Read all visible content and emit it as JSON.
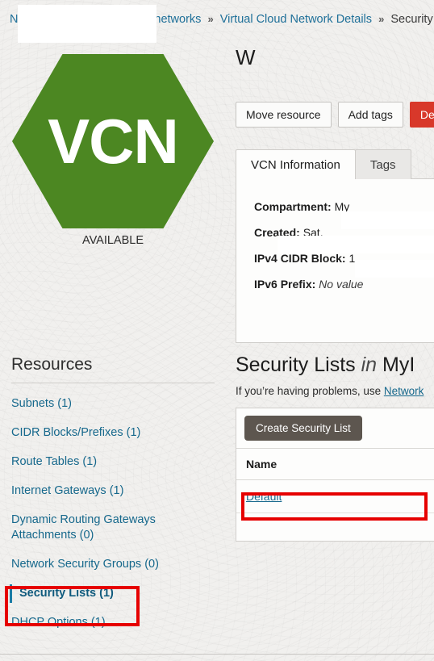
{
  "breadcrumb": {
    "items": [
      {
        "label": "Networking",
        "link": true
      },
      {
        "label": "Virtual cloud networks",
        "link": true
      },
      {
        "label": "Virtual Cloud Network Details",
        "link": true
      },
      {
        "label": "Security Lists",
        "link": false
      }
    ],
    "separator": "»"
  },
  "resource_badge": {
    "hex_label": "VCN",
    "hex_color": "#4c8722",
    "status": "AVAILABLE"
  },
  "detail": {
    "title": "W",
    "buttons": [
      {
        "label": "Move resource",
        "style": "default"
      },
      {
        "label": "Add tags",
        "style": "default"
      },
      {
        "label": "Dele",
        "style": "danger"
      }
    ],
    "tabs": [
      {
        "label": "VCN Information",
        "active": true
      },
      {
        "label": "Tags",
        "active": false
      }
    ],
    "info": [
      {
        "label": "Compartment:",
        "value": "My",
        "italic": false
      },
      {
        "label": "Created:",
        "value": "Sat,",
        "italic": false
      },
      {
        "label": "IPv4 CIDR Block:",
        "value": "1",
        "italic": false
      },
      {
        "label": "IPv6 Prefix:",
        "value": "No value",
        "italic": true
      }
    ]
  },
  "resources": {
    "heading": "Resources",
    "items": [
      {
        "label": "Subnets (1)",
        "active": false
      },
      {
        "label": "CIDR Blocks/Prefixes (1)",
        "active": false
      },
      {
        "label": "Route Tables (1)",
        "active": false
      },
      {
        "label": "Internet Gateways (1)",
        "active": false
      },
      {
        "label": "Dynamic Routing Gateways Attachments (0)",
        "active": false
      },
      {
        "label": "Network Security Groups (0)",
        "active": false
      },
      {
        "label": "Security Lists (1)",
        "active": true
      },
      {
        "label": "DHCP Options (1)",
        "active": false
      }
    ]
  },
  "security_lists": {
    "title_main": "Security Lists ",
    "title_italic": "in",
    "title_tail": " MyI",
    "subtitle_before": "If you’re having problems, use ",
    "subtitle_link": "Network",
    "create_button": "Create Security List",
    "column_header": "Name",
    "rows": [
      {
        "name": "Default "
      }
    ]
  },
  "annotations": {
    "color": "#e60000",
    "targets": [
      "sidebar-security-lists",
      "table-row-default"
    ]
  }
}
